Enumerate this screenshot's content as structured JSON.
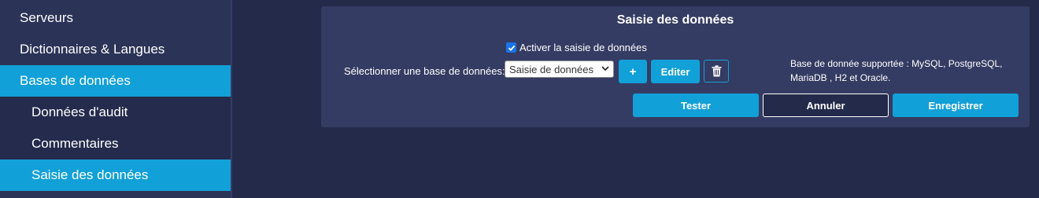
{
  "sidebar": {
    "items": [
      {
        "label": "Serveurs"
      },
      {
        "label": "Dictionnaires & Langues"
      },
      {
        "label": "Bases de données"
      },
      {
        "label": "Données d'audit"
      },
      {
        "label": "Commentaires"
      },
      {
        "label": "Saisie des données"
      }
    ]
  },
  "panel": {
    "title": "Saisie des données",
    "checkbox_label": "Activer la saisie de données",
    "checkbox_checked": true,
    "select_label": "Sélectionner une base de données:",
    "select_value": "Saisie de données",
    "add_label": "+",
    "edit_label": "Editer",
    "trash_icon": "trash-icon",
    "note": "Base de donnée supportée : MySQL, PostgreSQL, MariaDB , H2 et Oracle.",
    "tester_label": "Tester",
    "annuler_label": "Annuler",
    "save_label": "Enregistrer"
  },
  "colors": {
    "accent": "#12a0d8",
    "background": "#232a4a",
    "sidebar": "#2b3357",
    "panel": "#353c63"
  }
}
